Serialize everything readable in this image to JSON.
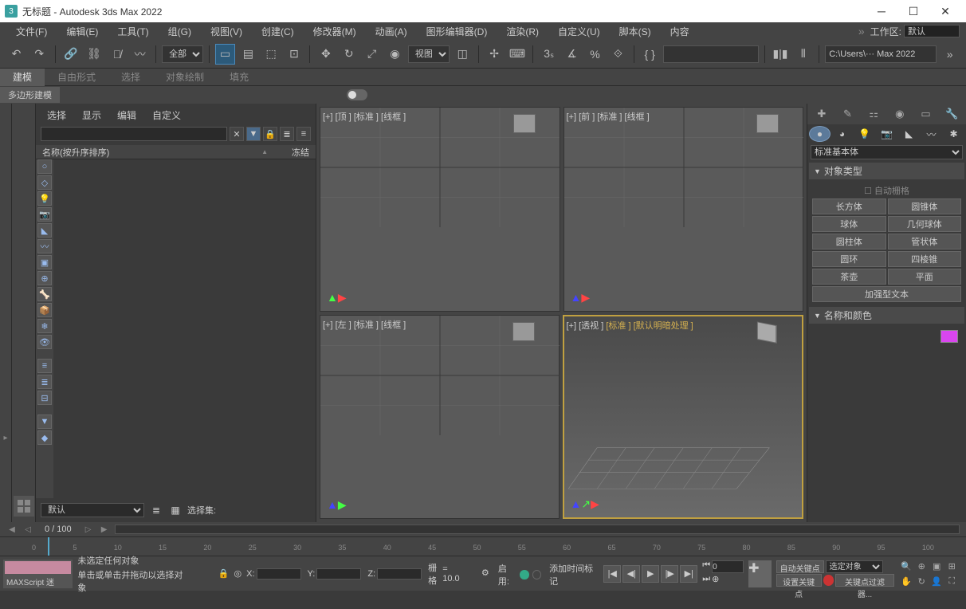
{
  "title": "无标题 - Autodesk 3ds Max 2022",
  "menu": {
    "file": "文件(F)",
    "edit": "编辑(E)",
    "tools": "工具(T)",
    "group": "组(G)",
    "view": "视图(V)",
    "create": "创建(C)",
    "modify": "修改器(M)",
    "anim": "动画(A)",
    "graph": "图形编辑器(D)",
    "render": "渲染(R)",
    "custom": "自定义(U)",
    "script": "脚本(S)",
    "content": "内容",
    "workspace_label": "工作区:",
    "workspace_value": "默认"
  },
  "toolbar": {
    "filter": "全部",
    "refsys": "视图",
    "path": "C:\\Users\\··· Max 2022"
  },
  "ribbon": {
    "modeling": "建模",
    "freeform": "自由形式",
    "select": "选择",
    "objpaint": "对象绘制",
    "fill": "填充",
    "sub": "多边形建模"
  },
  "scene": {
    "tab_select": "选择",
    "tab_display": "显示",
    "tab_edit": "编辑",
    "tab_custom": "自定义",
    "col_name": "名称(按升序排序)",
    "col_frozen": "冻结",
    "default": "默认",
    "selset": "选择集:"
  },
  "viewports": {
    "top": "[+] [顶 ] [标准 ] [线框 ]",
    "front": "[+] [前 ] [标准 ] [线框 ]",
    "left": "[+] [左 ] [标准 ] [线框 ]",
    "persp_plus": "[+] ",
    "persp_view": "[透视 ] ",
    "persp_std": "[标准 ] ",
    "persp_shade": "[默认明暗处理 ]"
  },
  "cmd": {
    "category": "标准基本体",
    "objtype_title": "对象类型",
    "autogrid": "自动栅格",
    "box": "长方体",
    "cone": "圆锥体",
    "sphere": "球体",
    "geosphere": "几何球体",
    "cyl": "圆柱体",
    "tube": "管状体",
    "torus": "圆环",
    "pyramid": "四棱锥",
    "teapot": "茶壶",
    "plane": "平面",
    "text": "加强型文本",
    "namecolor_title": "名称和颜色"
  },
  "time": {
    "frame": "0  /  100"
  },
  "timeline_ticks": [
    "0",
    "5",
    "10",
    "15",
    "20",
    "25",
    "30",
    "35",
    "40",
    "45",
    "50",
    "55",
    "60",
    "65",
    "70",
    "75",
    "80",
    "85",
    "90",
    "95",
    "100"
  ],
  "status": {
    "maxscript": "MAXScript 迷",
    "nosel": "未选定任何对象",
    "hint": "单击或单击并拖动以选择对象",
    "x": "X:",
    "y": "Y:",
    "z": "Z:",
    "grid": "栅格",
    "gridval": "= 10.0",
    "enable_label": "启用:",
    "addmark": "添加时间标记",
    "autokey": "自动关键点",
    "setkey": "设置关键点",
    "selobj": "选定对象",
    "keyfilter": "关键点过滤器..."
  }
}
